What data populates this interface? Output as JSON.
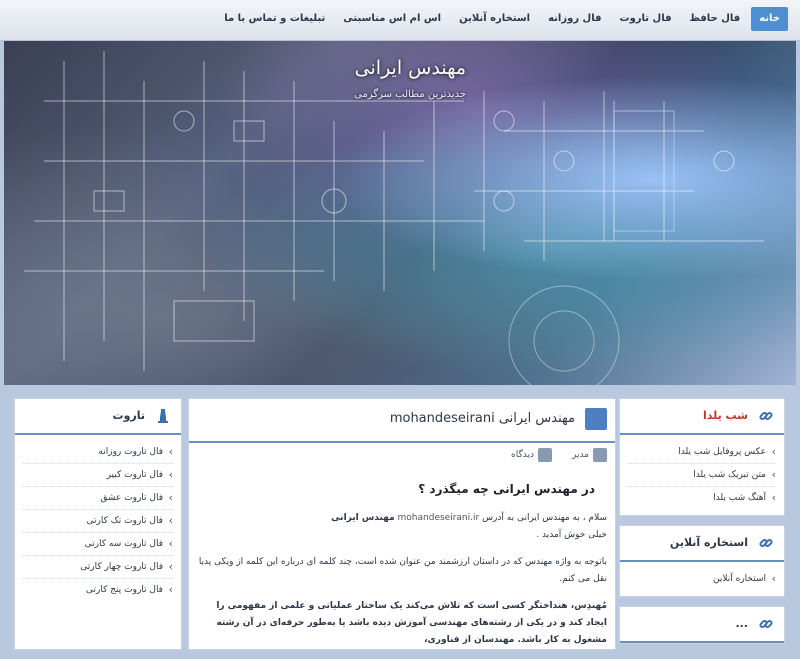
{
  "nav": {
    "items": [
      "خانه",
      "فال حافظ",
      "فال تاروت",
      "فال روزانه",
      "استخاره آنلاین",
      "اس ام اس مناسبتی",
      "تبلیغات و تماس با ما"
    ]
  },
  "header": {
    "title": "مهندس ایرانی",
    "tagline": "جدیدترین مطالب سرگرمی"
  },
  "colors": {
    "accent": "#4e8fd1",
    "red_title": "#c0392b",
    "divider": "#6a8fc4"
  },
  "right_sidebar": {
    "box1": {
      "title": "شب یلدا",
      "icon": "link-icon",
      "items": [
        "عکس پروفایل شب یلدا",
        "متن تبریک شب یلدا",
        "آهنگ شب یلدا"
      ]
    },
    "box2": {
      "title": "استخاره آنلاین",
      "icon": "link-icon",
      "items": [
        "استخاره آنلاین"
      ]
    },
    "box3": {
      "title": "...",
      "icon": "link-icon"
    }
  },
  "post": {
    "title": "مهندس ایرانی mohandeseirani",
    "author": "مدیر",
    "comments": "دیدگاه",
    "heading": "در مهندس ایرانی چه میگذرد ؟",
    "para1_a": "سلام ، به مهندس ایرانی به آدرس",
    "para1_site": "mohandeseirani.ir",
    "para1_label": "مهندس ایرانی",
    "para1_b": "خیلی خوش آمدید .",
    "para2": "باتوجه به واژه مهندس که در داستان ارزشمند من عنوان شده است، چند کلمه ای درباره این کلمه از ویکی پدیا نقل می کنم.",
    "para3": "مُهندِس، هنداختگر کسی است که تلاش می‌کند یک ساختار عملیاتی و علمی از مفهومی را ایجاد کند و در یکی از رشته‌های مهندسی آموزش دیده باشد یا به‌طور حرفه‌ای در آن رشته مشغول به کار باشد. مهندسان از فناوری،"
  },
  "left_sidebar": {
    "title": "تاروت",
    "icon": "chess-piece-icon",
    "items": [
      "فال تاروت روزانه",
      "فال تاروت کبیر",
      "فال تاروت عشق",
      "فال تاروت تک کارتی",
      "فال تاروت سه کارتی",
      "فال تاروت چهار کارتی",
      "فال تاروت پنج کارتی"
    ]
  }
}
